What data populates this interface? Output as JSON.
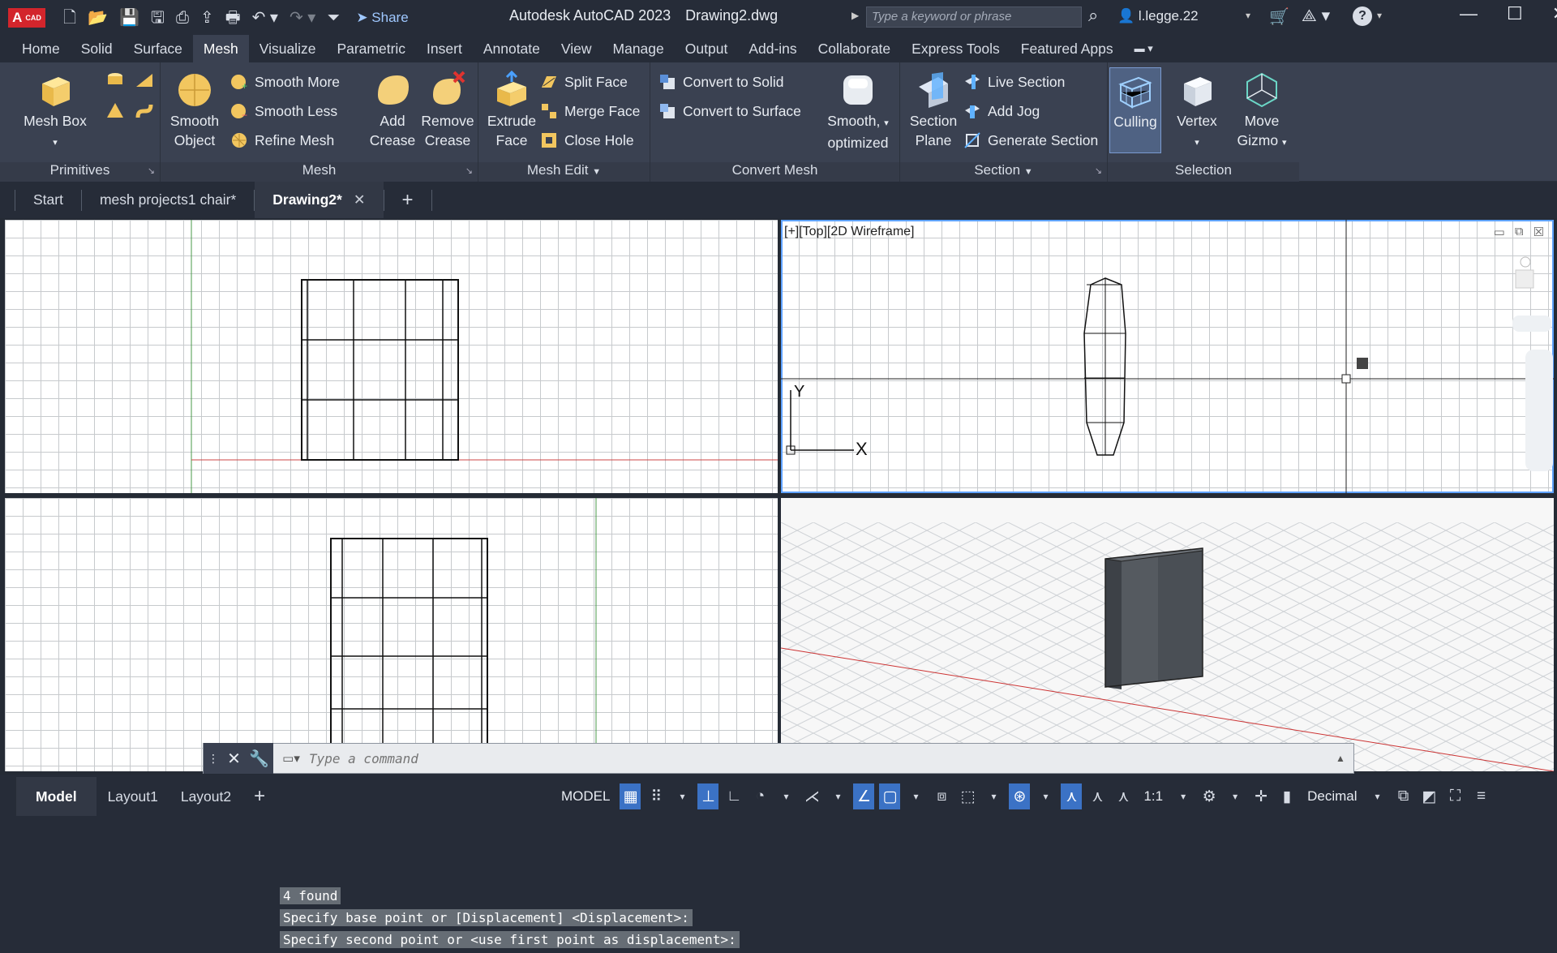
{
  "app": {
    "logo_text": "A",
    "logo_sub": "CAD",
    "title": "Autodesk AutoCAD 2023",
    "filename": "Drawing2.dwg",
    "share_label": "Share",
    "search_placeholder": "Type a keyword or phrase",
    "username": "l.legge.22",
    "help_label": "?"
  },
  "ribbon_tabs": [
    "Home",
    "Solid",
    "Surface",
    "Mesh",
    "Visualize",
    "Parametric",
    "Insert",
    "Annotate",
    "View",
    "Manage",
    "Output",
    "Add-ins",
    "Collaborate",
    "Express Tools",
    "Featured Apps"
  ],
  "active_tab": "Mesh",
  "panels": {
    "primitives": {
      "title": "Primitives",
      "mesh_box": "Mesh Box"
    },
    "mesh": {
      "title": "Mesh",
      "smooth_object_1": "Smooth",
      "smooth_object_2": "Object",
      "smooth_more": "Smooth More",
      "smooth_less": "Smooth Less",
      "refine_mesh": "Refine Mesh",
      "add_crease_1": "Add",
      "add_crease_2": "Crease",
      "remove_crease_1": "Remove",
      "remove_crease_2": "Crease"
    },
    "mesh_edit": {
      "title": "Mesh Edit",
      "extrude_1": "Extrude",
      "extrude_2": "Face",
      "split_face": "Split Face",
      "merge_face": "Merge Face",
      "close_hole": "Close Hole"
    },
    "convert_mesh": {
      "title": "Convert Mesh",
      "convert_solid": "Convert to Solid",
      "convert_surface": "Convert to Surface",
      "smooth_opt_1": "Smooth,",
      "smooth_opt_2": "optimized"
    },
    "section": {
      "title": "Section",
      "section_plane_1": "Section",
      "section_plane_2": "Plane",
      "live_section": "Live Section",
      "add_jog": "Add Jog",
      "generate_section": "Generate Section"
    },
    "selection": {
      "title": "Selection",
      "culling": "Culling",
      "vertex": "Vertex",
      "move_gizmo_1": "Move",
      "move_gizmo_2": "Gizmo"
    }
  },
  "doc_tabs": [
    "Start",
    "mesh projects1 chair*",
    "Drawing2*"
  ],
  "active_doc": "Drawing2*",
  "viewport_tr_label": "[+][Top][2D Wireframe]",
  "command_history": [
    "4 found",
    "Specify base point or [Displacement] <Displacement>:",
    "Specify second point or <use first point as displacement>:"
  ],
  "command_placeholder": "Type a command",
  "layout_tabs": [
    "Model",
    "Layout1",
    "Layout2"
  ],
  "status": {
    "model": "MODEL",
    "scale": "1:1",
    "units": "Decimal"
  }
}
